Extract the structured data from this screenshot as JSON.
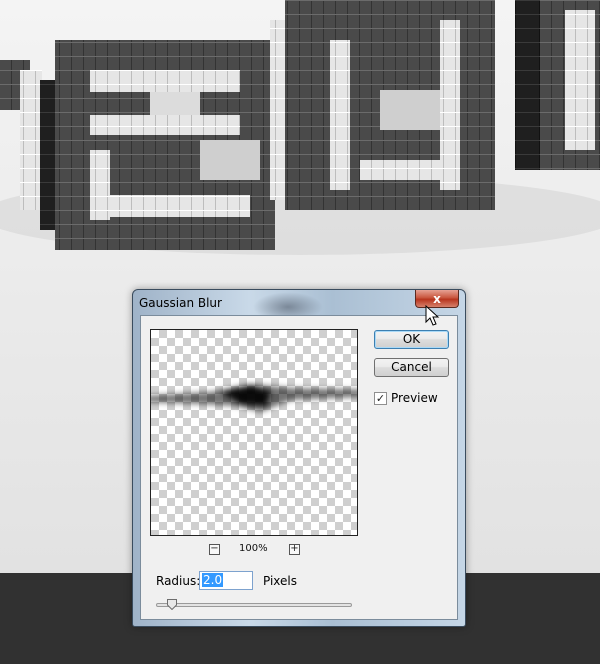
{
  "dialog": {
    "title": "Gaussian Blur",
    "close_label": "x",
    "ok_label": "OK",
    "cancel_label": "Cancel",
    "preview_label": "Preview",
    "preview_checked": true,
    "zoom_level": "100%",
    "zoom_out_label": "−",
    "zoom_in_label": "+",
    "radius_label": "Radius:",
    "radius_value": "2.0",
    "radius_unit": "Pixels",
    "radius_slider_fraction": 0.08
  },
  "colors": {
    "close_button": "#c9573f",
    "floor": "#313131",
    "selection": "#3399ff",
    "brick_dark": "#4a4a4a",
    "brick_light": "#e6e6e6"
  }
}
